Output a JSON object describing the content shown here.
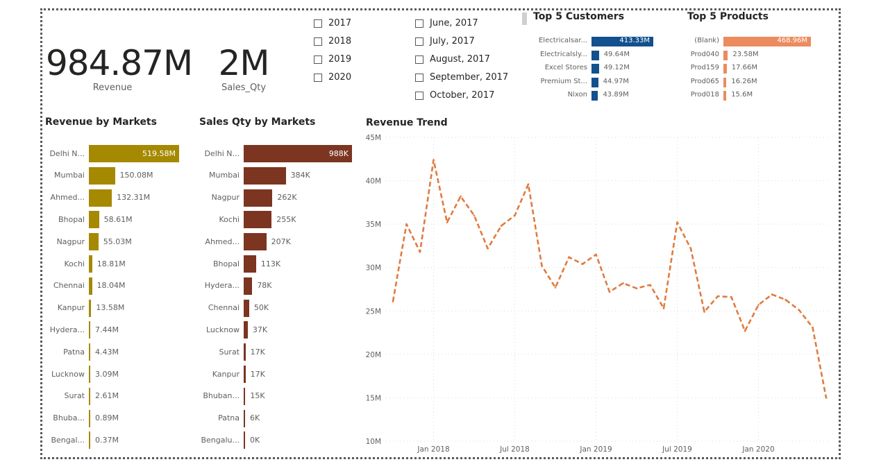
{
  "kpis": {
    "revenue": {
      "value": "984.87M",
      "label": "Revenue"
    },
    "sales_qty": {
      "value": "2M",
      "label": "Sales_Qty"
    }
  },
  "year_slicer": [
    "2017",
    "2018",
    "2019",
    "2020"
  ],
  "month_slicer": [
    "June, 2017",
    "July, 2017",
    "August, 2017",
    "September, 2017",
    "October, 2017"
  ],
  "chart_data": [
    {
      "id": "top5_customers",
      "type": "bar",
      "title": "Top 5 Customers",
      "categories": [
        "Electricalsar...",
        "Electricalsly...",
        "Excel Stores",
        "Premium St...",
        "Nixon"
      ],
      "values": [
        413.33,
        49.64,
        49.12,
        44.97,
        43.89
      ],
      "labels": [
        "413.33M",
        "49.64M",
        "49.12M",
        "44.97M",
        "43.89M"
      ],
      "color": "#12508e"
    },
    {
      "id": "top5_products",
      "type": "bar",
      "title": "Top 5 Products",
      "categories": [
        "(Blank)",
        "Prod040",
        "Prod159",
        "Prod065",
        "Prod018"
      ],
      "values": [
        468.96,
        23.58,
        17.66,
        16.26,
        15.6
      ],
      "labels": [
        "468.96M",
        "23.58M",
        "17.66M",
        "16.26M",
        "15.6M"
      ],
      "color": "#ec8b5e"
    },
    {
      "id": "revenue_by_markets",
      "type": "bar",
      "title": "Revenue by Markets",
      "categories": [
        "Delhi N...",
        "Mumbai",
        "Ahmed...",
        "Bhopal",
        "Nagpur",
        "Kochi",
        "Chennai",
        "Kanpur",
        "Hydera...",
        "Patna",
        "Lucknow",
        "Surat",
        "Bhuba...",
        "Bengal..."
      ],
      "values": [
        519.58,
        150.08,
        132.31,
        58.61,
        55.03,
        18.81,
        18.04,
        13.58,
        7.44,
        4.43,
        3.09,
        2.61,
        0.89,
        0.37
      ],
      "labels": [
        "519.58M",
        "150.08M",
        "132.31M",
        "58.61M",
        "55.03M",
        "18.81M",
        "18.04M",
        "13.58M",
        "7.44M",
        "4.43M",
        "3.09M",
        "2.61M",
        "0.89M",
        "0.37M"
      ],
      "color": "#a58900"
    },
    {
      "id": "sales_qty_by_markets",
      "type": "bar",
      "title": "Sales Qty by Markets",
      "categories": [
        "Delhi N...",
        "Mumbai",
        "Nagpur",
        "Kochi",
        "Ahmed...",
        "Bhopal",
        "Hydera...",
        "Chennai",
        "Lucknow",
        "Surat",
        "Kanpur",
        "Bhuban...",
        "Patna",
        "Bengalu..."
      ],
      "values": [
        988,
        384,
        262,
        255,
        207,
        113,
        78,
        50,
        37,
        17,
        17,
        15,
        6,
        0.4
      ],
      "labels": [
        "988K",
        "384K",
        "262K",
        "255K",
        "207K",
        "113K",
        "78K",
        "50K",
        "37K",
        "17K",
        "17K",
        "15K",
        "6K",
        "0K"
      ],
      "color": "#7b3520"
    },
    {
      "id": "revenue_trend",
      "type": "line",
      "title": "Revenue Trend",
      "x": [
        "2017-10",
        "2017-11",
        "2017-12",
        "2018-01",
        "2018-02",
        "2018-03",
        "2018-04",
        "2018-05",
        "2018-06",
        "2018-07",
        "2018-08",
        "2018-09",
        "2018-10",
        "2018-11",
        "2018-12",
        "2019-01",
        "2019-02",
        "2019-03",
        "2019-04",
        "2019-05",
        "2019-06",
        "2019-07",
        "2019-08",
        "2019-09",
        "2019-10",
        "2019-11",
        "2019-12",
        "2020-01",
        "2020-02",
        "2020-03",
        "2020-04",
        "2020-05",
        "2020-06"
      ],
      "y": [
        26.1,
        35.0,
        31.8,
        42.4,
        35.2,
        38.2,
        36.0,
        32.2,
        34.8,
        36.0,
        39.6,
        30.2,
        27.7,
        31.2,
        30.4,
        31.5,
        27.2,
        28.2,
        27.6,
        28.0,
        25.3,
        35.2,
        32.2,
        24.9,
        26.7,
        26.6,
        22.7,
        25.7,
        26.9,
        26.3,
        25.1,
        23.1,
        15.0
      ],
      "yticks": [
        "10M",
        "15M",
        "20M",
        "25M",
        "30M",
        "35M",
        "40M",
        "45M"
      ],
      "ylim": [
        10,
        45
      ],
      "xticks": [
        {
          "label": "Jan 2018",
          "at": "2018-01"
        },
        {
          "label": "Jul 2018",
          "at": "2018-07"
        },
        {
          "label": "Jan 2019",
          "at": "2019-01"
        },
        {
          "label": "Jul 2019",
          "at": "2019-07"
        },
        {
          "label": "Jan 2020",
          "at": "2020-01"
        }
      ],
      "grid": true,
      "line_style": "dashed",
      "color": "#e07b3f"
    }
  ]
}
